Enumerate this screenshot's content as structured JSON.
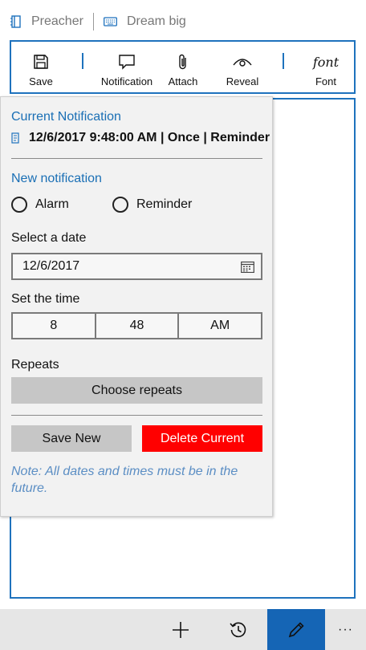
{
  "breadcrumb": {
    "items": [
      {
        "label": "Preacher",
        "icon": "notebook-icon"
      },
      {
        "label": "Dream big",
        "icon": "keyboard-icon"
      }
    ]
  },
  "toolbar": {
    "save": "Save",
    "notification": "Notification",
    "attach": "Attach",
    "reveal": "Reveal",
    "font": "Font",
    "font_glyph": "font"
  },
  "flyout": {
    "current_header": "Current Notification",
    "current_value": "12/6/2017 9:48:00 AM | Once | Reminder",
    "new_header": "New notification",
    "radio_alarm": "Alarm",
    "radio_reminder": "Reminder",
    "date_label": "Select a date",
    "date_value": "12/6/2017",
    "time_label": "Set the time",
    "time_hour": "8",
    "time_minute": "48",
    "time_period": "AM",
    "repeats_label": "Repeats",
    "choose_repeats": "Choose repeats",
    "save_new": "Save New",
    "delete_current": "Delete Current",
    "note": "Note: All dates and times must be in the future."
  },
  "appbar": {
    "more": "···"
  },
  "colors": {
    "accent": "#1e72bd",
    "delete": "#ff0000",
    "active_appbar": "#1565b5",
    "button_gray": "#c6c6c6"
  }
}
